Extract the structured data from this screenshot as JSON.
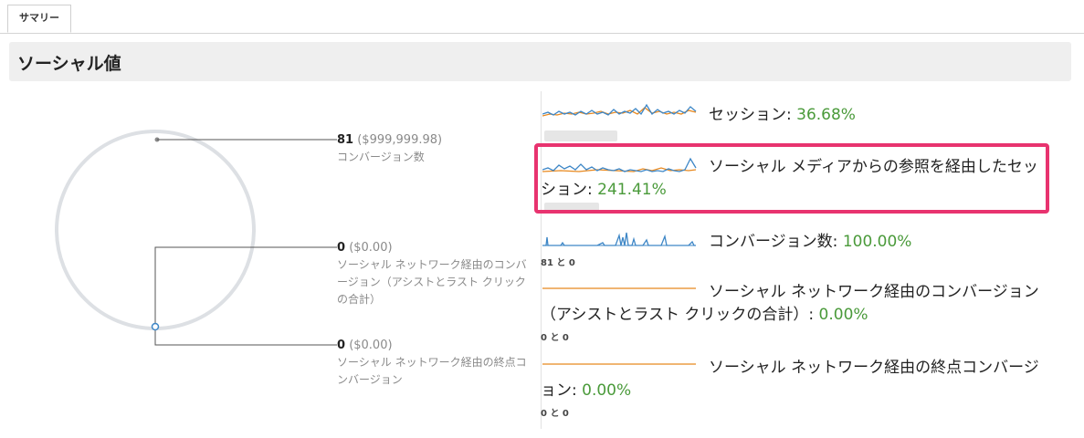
{
  "tab": {
    "label": "サマリー"
  },
  "section": {
    "title": "ソーシャル値"
  },
  "left_stats": [
    {
      "count": "81",
      "value": "($999,999.98)",
      "label": "コンバージョン数"
    },
    {
      "count": "0",
      "value": "($0.00)",
      "label": "ソーシャル ネットワーク経由のコンバージョン（アシストとラスト クリックの合計）"
    },
    {
      "count": "0",
      "value": "($0.00)",
      "label": "ソーシャル ネットワーク経由の終点コンバージョン"
    }
  ],
  "metrics": [
    {
      "label": "セッション",
      "pct": "36.68%"
    },
    {
      "label": "ソーシャル メディアからの参照を経由したセッション",
      "pct": "241.41%"
    },
    {
      "label": "コンバージョン数",
      "pct": "100.00%",
      "sub": "81 と 0"
    },
    {
      "label": "ソーシャル ネットワーク経由のコンバージョン（アシストとラスト クリックの合計）",
      "pct": "0.00%",
      "sub": "0 と 0"
    },
    {
      "label": "ソーシャル ネットワーク経由の終点コンバージョン",
      "pct": "0.00%",
      "sub": "0 と 0"
    }
  ],
  "colors": {
    "accent_green": "#4a9a3a",
    "highlight": "#e8336f",
    "series_blue": "#3d86c6",
    "series_orange": "#e8891f"
  }
}
